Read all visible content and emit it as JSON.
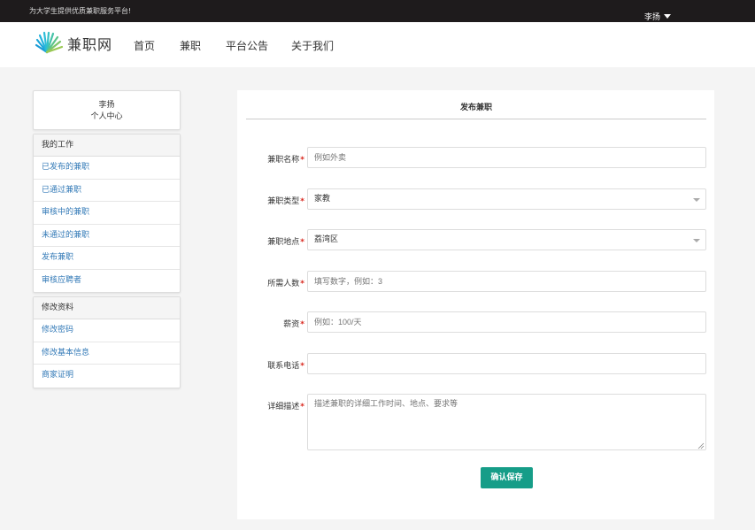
{
  "topbar": {
    "slogan": "为大学生提供优质兼职服务平台!",
    "username": "李扬"
  },
  "navbar": {
    "logo_text": "兼职网",
    "items": [
      "首页",
      "兼职",
      "平台公告",
      "关于我们"
    ]
  },
  "sidebar": {
    "profile": {
      "name": "李扬",
      "subtitle": "个人中心"
    },
    "groups": [
      {
        "title": "我的工作",
        "items": [
          "已发布的兼职",
          "已通过兼职",
          "审核中的兼职",
          "未通过的兼职",
          "发布兼职",
          "审核应聘者"
        ]
      },
      {
        "title": "修改资料",
        "items": [
          "修改密码",
          "修改基本信息",
          "商家证明"
        ]
      }
    ]
  },
  "form": {
    "title": "发布兼职",
    "required_mark": "*",
    "fields": [
      {
        "label": "兼职名称",
        "value": "",
        "placeholder": "例如外卖"
      },
      {
        "label": "兼职类型",
        "value": "家教",
        "placeholder": ""
      },
      {
        "label": "兼职地点",
        "value": "荔湾区",
        "placeholder": ""
      },
      {
        "label": "所需人数",
        "value": "",
        "placeholder": "填写数字，例如：3"
      },
      {
        "label": "薪资",
        "value": "",
        "placeholder": "例如：100/天"
      },
      {
        "label": "联系电话",
        "value": "",
        "placeholder": ""
      },
      {
        "label": "详细描述",
        "value": "",
        "placeholder": "描述兼职的详细工作时间、地点、要求等"
      }
    ],
    "submit_label": "确认保存"
  },
  "colors": {
    "topbar_bg": "#1e1b1c",
    "link": "#337ab7",
    "required": "#d9261c",
    "primary_button": "#169d88"
  },
  "icons": {
    "logo": "fan-logo-icon",
    "user_menu": "caret-down-icon",
    "select": "chevron-down-icon",
    "resize": "resize-grip-icon"
  }
}
